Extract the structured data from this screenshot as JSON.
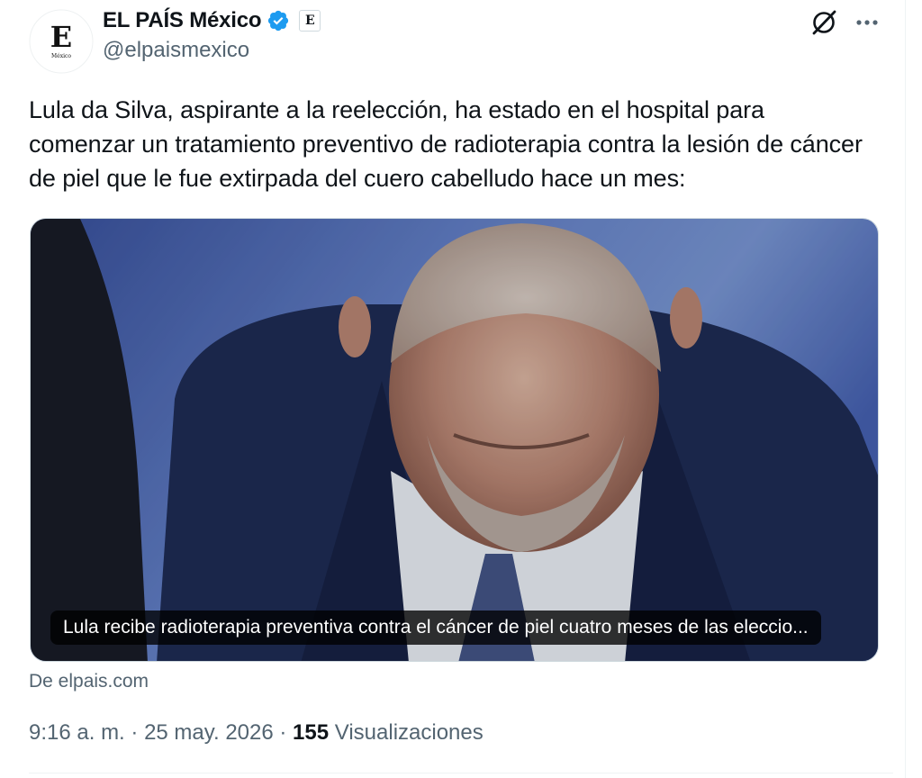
{
  "account": {
    "display_name": "EL PAÍS México",
    "handle": "@elpaismexico",
    "avatar_letter": "E",
    "avatar_sub": "México",
    "affiliate_letter": "E"
  },
  "tweet": {
    "text": "Lula da Silva, aspirante a la reelección, ha estado en el hospital para comenzar un tratamiento preventivo de radioterapia contra la lesión de cáncer de piel que le fue extirpada del cuero cabelludo hace un mes:"
  },
  "card": {
    "headline": "Lula recibe radioterapia preventiva contra el cáncer de piel cuatro meses de las eleccio...",
    "source": "De elpais.com"
  },
  "meta": {
    "time": "9:16 a. m.",
    "sep1": " · ",
    "date": "25 may. 2026",
    "sep2": " · ",
    "views_count": "155",
    "views_label": " Visualizaciones"
  },
  "icons": {
    "verified": "verified-badge-icon",
    "grok": "grok-icon",
    "more": "more-options-icon"
  },
  "colors": {
    "verified_blue": "#1d9bf0",
    "text_primary": "#0f1419",
    "text_secondary": "#536471"
  }
}
